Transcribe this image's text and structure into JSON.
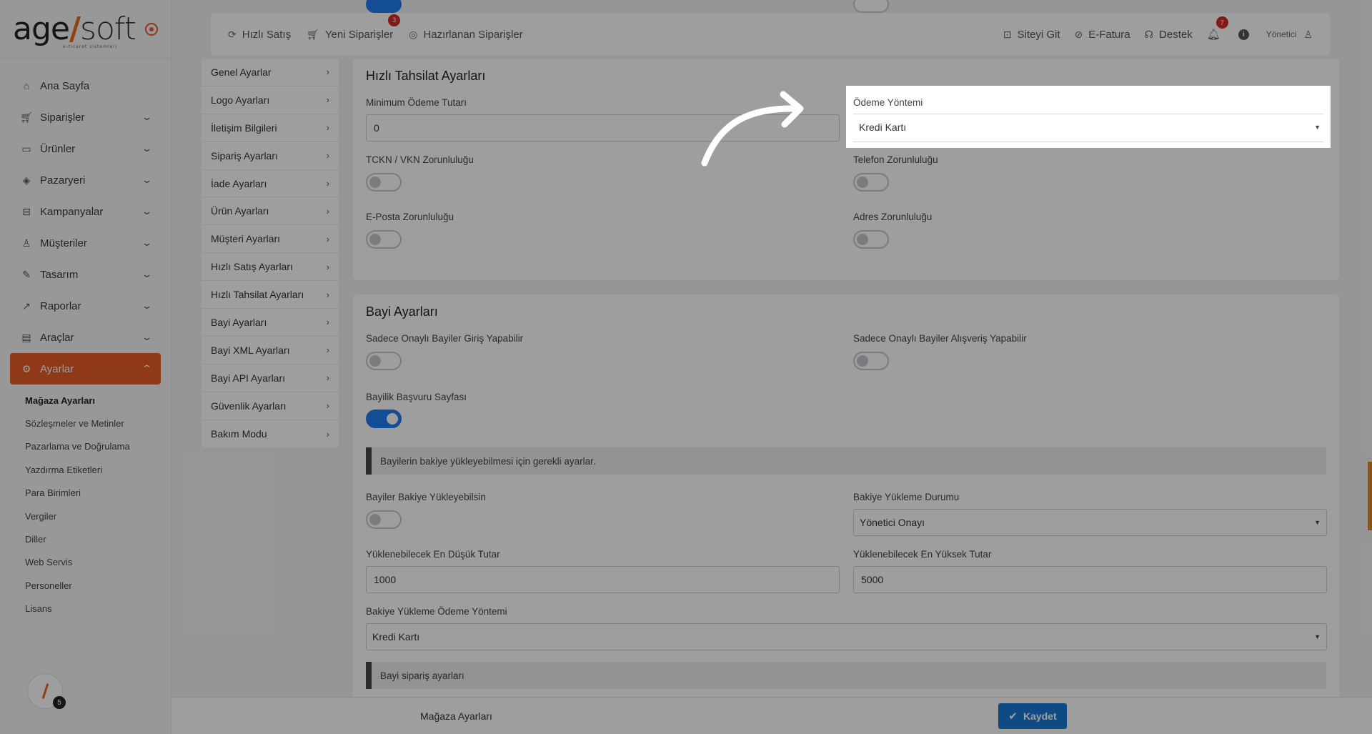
{
  "logo": {
    "text_main": "age",
    "text_slash": "/",
    "text_soft": "soft",
    "subtitle": "e-ticaret sistemleri"
  },
  "colors": {
    "accent": "#e85d28",
    "primary": "#1f7cf0",
    "badge": "#d42b2b"
  },
  "sidebar": {
    "items": [
      {
        "label": "Ana Sayfa",
        "icon": "home-icon"
      },
      {
        "label": "Siparişler",
        "icon": "cart-icon"
      },
      {
        "label": "Ürünler",
        "icon": "book-icon"
      },
      {
        "label": "Pazaryeri",
        "icon": "box-icon"
      },
      {
        "label": "Kampanyalar",
        "icon": "gift-icon"
      },
      {
        "label": "Müşteriler",
        "icon": "user-icon"
      },
      {
        "label": "Tasarım",
        "icon": "edit-icon"
      },
      {
        "label": "Raporlar",
        "icon": "chart-icon"
      },
      {
        "label": "Araçlar",
        "icon": "clipboard-icon"
      },
      {
        "label": "Ayarlar",
        "icon": "gear-icon"
      }
    ],
    "sub_items": [
      "Mağaza Ayarları",
      "Sözleşmeler ve Metinler",
      "Pazarlama ve Doğrulama",
      "Yazdırma Etiketleri",
      "Para Birimleri",
      "Vergiler",
      "Diller",
      "Web Servis",
      "Personeller",
      "Lisans"
    ],
    "help_badge": "5"
  },
  "topbar": {
    "quick_sale": "Hızlı Satış",
    "new_orders": "Yeni Siparişler",
    "new_orders_badge": "3",
    "prepared_orders": "Hazırlanan Siparişler",
    "go_site": "Siteyi Git",
    "e_invoice": "E-Fatura",
    "support": "Destek",
    "notifications_badge": "7",
    "info": "i",
    "user": "Yönetici"
  },
  "settings_menu": [
    "Genel Ayarlar",
    "Logo Ayarları",
    "İletişim Bilgileri",
    "Sipariş Ayarları",
    "İade Ayarları",
    "Ürün Ayarları",
    "Müşteri Ayarları",
    "Hızlı Satış Ayarları",
    "Hızlı Tahsilat Ayarları",
    "Bayi Ayarları",
    "Bayi XML Ayarları",
    "Bayi API Ayarları",
    "Güvenlik Ayarları",
    "Bakım Modu"
  ],
  "quick_collection": {
    "title": "Hızlı Tahsilat Ayarları",
    "min_amount_label": "Minimum Ödeme Tutarı",
    "min_amount_value": "0",
    "payment_method_label": "Ödeme Yöntemi",
    "payment_method_value": "Kredi Kartı",
    "tckn_label": "TCKN / VKN Zorunluluğu",
    "tckn_on": false,
    "phone_label": "Telefon Zorunluluğu",
    "phone_on": false,
    "email_label": "E-Posta Zorunluluğu",
    "email_on": false,
    "address_label": "Adres Zorunluluğu",
    "address_on": false
  },
  "dealer": {
    "title": "Bayi Ayarları",
    "approved_login_label": "Sadece Onaylı Bayiler Giriş Yapabilir",
    "approved_login_on": false,
    "approved_shop_label": "Sadece Onaylı Bayiler Alışveriş Yapabilir",
    "approved_shop_on": false,
    "application_page_label": "Bayilik Başvuru Sayfası",
    "application_page_on": true,
    "balance_note": "Bayilerin bakiye yükleyebilmesi için gerekli ayarlar.",
    "can_load_label": "Bayiler Bakiye Yükleyebilsin",
    "can_load_on": false,
    "load_status_label": "Bakiye Yükleme Durumu",
    "load_status_value": "Yönetici Onayı",
    "min_load_label": "Yüklenebilecek En Düşük Tutar",
    "min_load_value": "1000",
    "max_load_label": "Yüklenebilecek En Yüksek Tutar",
    "max_load_value": "5000",
    "load_payment_label": "Bakiye Yükleme Ödeme Yöntemi",
    "load_payment_value": "Kredi Kartı",
    "order_note": "Bayi sipariş ayarları"
  },
  "footer": {
    "title": "Mağaza Ayarları",
    "save_label": "Kaydet"
  }
}
